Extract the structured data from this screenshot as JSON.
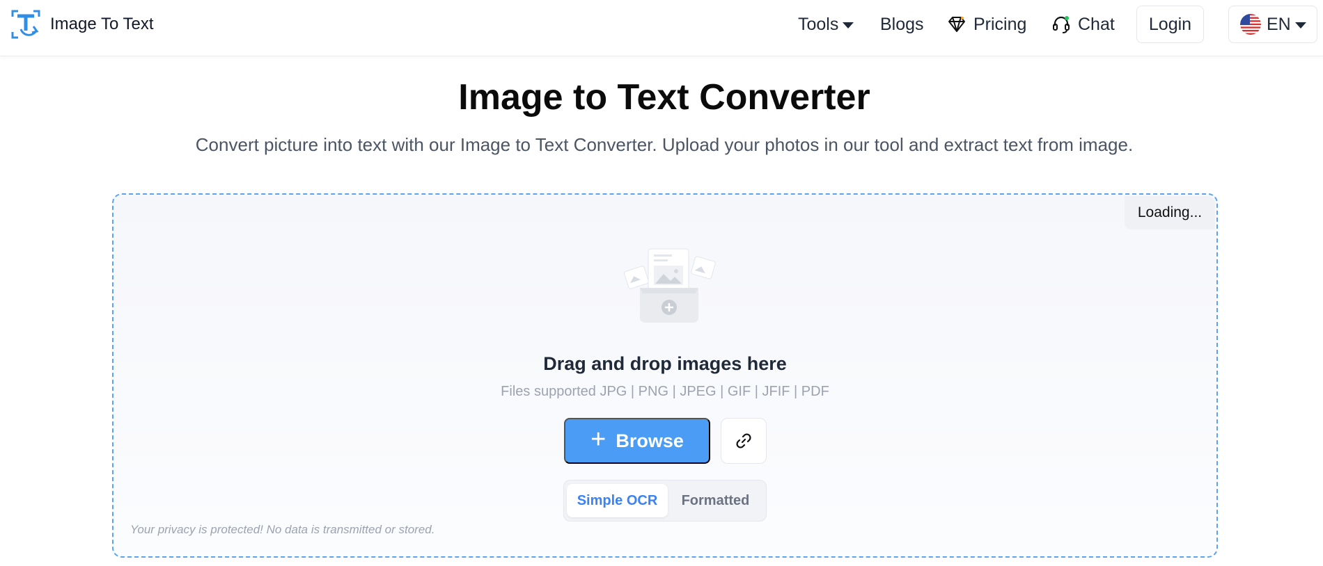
{
  "header": {
    "brand_name": "Image To Text",
    "nav": {
      "tools": "Tools",
      "blogs": "Blogs",
      "pricing": "Pricing",
      "chat": "Chat"
    },
    "login": "Login",
    "language": "EN"
  },
  "hero": {
    "title": "Image to Text Converter",
    "subtitle": "Convert picture into text with our Image to Text Converter. Upload your photos in our tool and extract text from image."
  },
  "upload": {
    "loading": "Loading...",
    "drag_title": "Drag and drop images here",
    "formats": "Files supported JPG | PNG | JPEG | GIF | JFIF | PDF",
    "browse_label": "Browse",
    "ocr_modes": [
      "Simple OCR",
      "Formatted"
    ],
    "selected_mode": "Simple OCR",
    "privacy": "Your privacy is protected! No data is transmitted or stored."
  },
  "colors": {
    "accent": "#4a9cf4",
    "brand_blue": "#2f8fe6",
    "dropzone_border": "#5aa3f0"
  },
  "icons": [
    "logo-icon",
    "caret-down-icon",
    "diamond-icon",
    "headset-icon",
    "us-flag-icon",
    "upload-illustration-icon",
    "plus-icon",
    "link-icon"
  ]
}
